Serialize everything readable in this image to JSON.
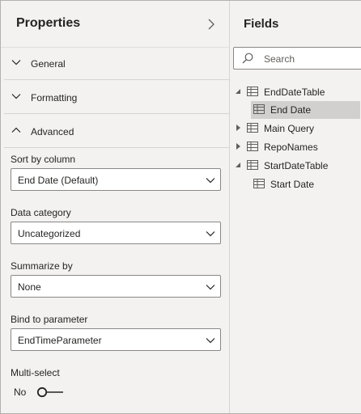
{
  "properties": {
    "title": "Properties",
    "sections": [
      {
        "label": "General",
        "expanded": false
      },
      {
        "label": "Formatting",
        "expanded": false
      },
      {
        "label": "Advanced",
        "expanded": true
      }
    ],
    "advanced": {
      "sort_by_column": {
        "label": "Sort by column",
        "value": "End Date (Default)"
      },
      "data_category": {
        "label": "Data category",
        "value": "Uncategorized"
      },
      "summarize_by": {
        "label": "Summarize by",
        "value": "None"
      },
      "bind_to_parameter": {
        "label": "Bind to parameter",
        "value": "EndTimeParameter"
      },
      "multi_select": {
        "label": "Multi-select",
        "state_text": "No",
        "on": false
      }
    }
  },
  "fields": {
    "title": "Fields",
    "search_placeholder": "Search",
    "tree": [
      {
        "label": "EndDateTable",
        "kind": "table",
        "expanded": true
      },
      {
        "label": "End Date",
        "kind": "column",
        "selected": true
      },
      {
        "label": "Main Query",
        "kind": "table",
        "expanded": false
      },
      {
        "label": "RepoNames",
        "kind": "table",
        "expanded": false
      },
      {
        "label": "StartDateTable",
        "kind": "table",
        "expanded": true
      },
      {
        "label": "Start Date",
        "kind": "column",
        "selected": false
      }
    ]
  },
  "colors": {
    "pane_bg": "#f3f2f1",
    "selected_bg": "#d2d0ce",
    "border": "#8a8886",
    "text": "#252423"
  }
}
